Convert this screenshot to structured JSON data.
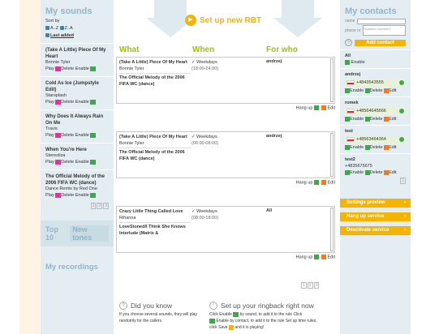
{
  "my_sounds": {
    "title": "My sounds",
    "sort_by": "Sort by",
    "sort_az": "A..Z",
    "sort_za": "Z..A",
    "last_added": "Last added",
    "songs": [
      {
        "title": "(Take A Little) Piece Of My Heart",
        "artist": "Bonnie Tyler",
        "play": "Play",
        "delete": "Delete",
        "enable": "Enable"
      },
      {
        "title": "Cold As Ice (Jumpstyle Edit)",
        "artist": "Starsplash",
        "play": "Play",
        "delete": "Delete",
        "enable": "Enable"
      },
      {
        "title": "Why Does It Always Rain On Me",
        "artist": "Travis",
        "play": "Play",
        "delete": "Delete",
        "enable": "Enable"
      },
      {
        "title": "When You're Here",
        "artist": "Stereoliza",
        "play": "Play",
        "delete": "Delete",
        "enable": "Enable"
      },
      {
        "title": "The Official Melody of the 2006 FIFA WC (dance)",
        "artist": "Dance Remix by Red One",
        "play": "Play",
        "delete": "Delete",
        "enable": "Enable"
      }
    ],
    "pager": [
      "1",
      "2",
      "3"
    ],
    "top10": "Top 10",
    "new_tones": "New tones",
    "my_recordings": "My recordings"
  },
  "center": {
    "setup_label": "Set up new RBT",
    "col_what": "What",
    "col_when": "When",
    "col_who": "For who",
    "rules": [
      {
        "songs": [
          "(Take A Little) Piece Of My Heart",
          "The Official Melody of the 2006 FIFA WC (dance)"
        ],
        "artist": "Bonnie Tyler",
        "when": "Weekdays",
        "time": "(18:00-24:00)",
        "who": "andrzej",
        "hangup": "Hang up",
        "edit": "Edit"
      },
      {
        "songs": [
          "(Take A Little) Piece Of My Heart",
          "The Official Melody of the 2006 FIFA WC (dance)"
        ],
        "artist": "Bonnie Tyler",
        "when": "Weekdays",
        "time": "(00:00-08:00)",
        "who": "andrzej",
        "hangup": "Hang up",
        "edit": "Edit"
      },
      {
        "songs": [
          "Crazy Little Thing Called Love",
          "LoveStoned/I Think She Knows Interlude (Matrix &"
        ],
        "artist": "Rihanna",
        "when": "Weekdays",
        "time": "(08:00-18:00)",
        "who": "All",
        "hangup": "Hang up",
        "edit": "Edit"
      }
    ],
    "pager": [
      "1",
      "2",
      "3"
    ],
    "dyk_title": "Did you know",
    "dyk_text": "If you choose several sounds, they will play randomly for the callers.",
    "setup_title": "Set up your ringback right now",
    "setup_line1": "Click Enable",
    "setup_line1b": "by sound, to add it to the rule Click",
    "setup_line2": "Enable by contact, to add it to the rule Set up time rules,",
    "setup_line3": "click Save",
    "setup_line3b": "and it is playing!"
  },
  "contacts": {
    "title": "My contacts",
    "name_label": "name",
    "phone_label": "phone nr",
    "number_placeholder": "Number/ Number2",
    "add_contact": "Add contact",
    "all": "All",
    "all_enable": "Enable",
    "list": [
      {
        "name": "andrzej",
        "number": "+4843543555",
        "enable": "Enable",
        "delete": "Delete",
        "edit": "Edit"
      },
      {
        "name": "romek",
        "number": "+48564645666",
        "enable": "Enable",
        "delete": "Delete",
        "edit": "Edit"
      },
      {
        "name": "test",
        "number": "+48563464364",
        "enable": "Enable",
        "delete": "Delete",
        "edit": "Edit"
      },
      {
        "name": "test2",
        "number": "+4835675675",
        "enable": "Enable",
        "delete": "Delete",
        "edit": "Edit"
      }
    ],
    "pager": "1",
    "settings_preview": "Settings preview",
    "hang_up_service": "Hang up service",
    "deactivate_service": "Deactivate service"
  },
  "colors": {
    "accent": "#f4b400",
    "header_green": "#9cc400",
    "sidebar_bg": "#e3edf2",
    "sidebar_title": "#8fb6c9",
    "enable_green": "#3fa84a",
    "delete_pink": "#d63b92",
    "edit_orange": "#f47a20"
  }
}
